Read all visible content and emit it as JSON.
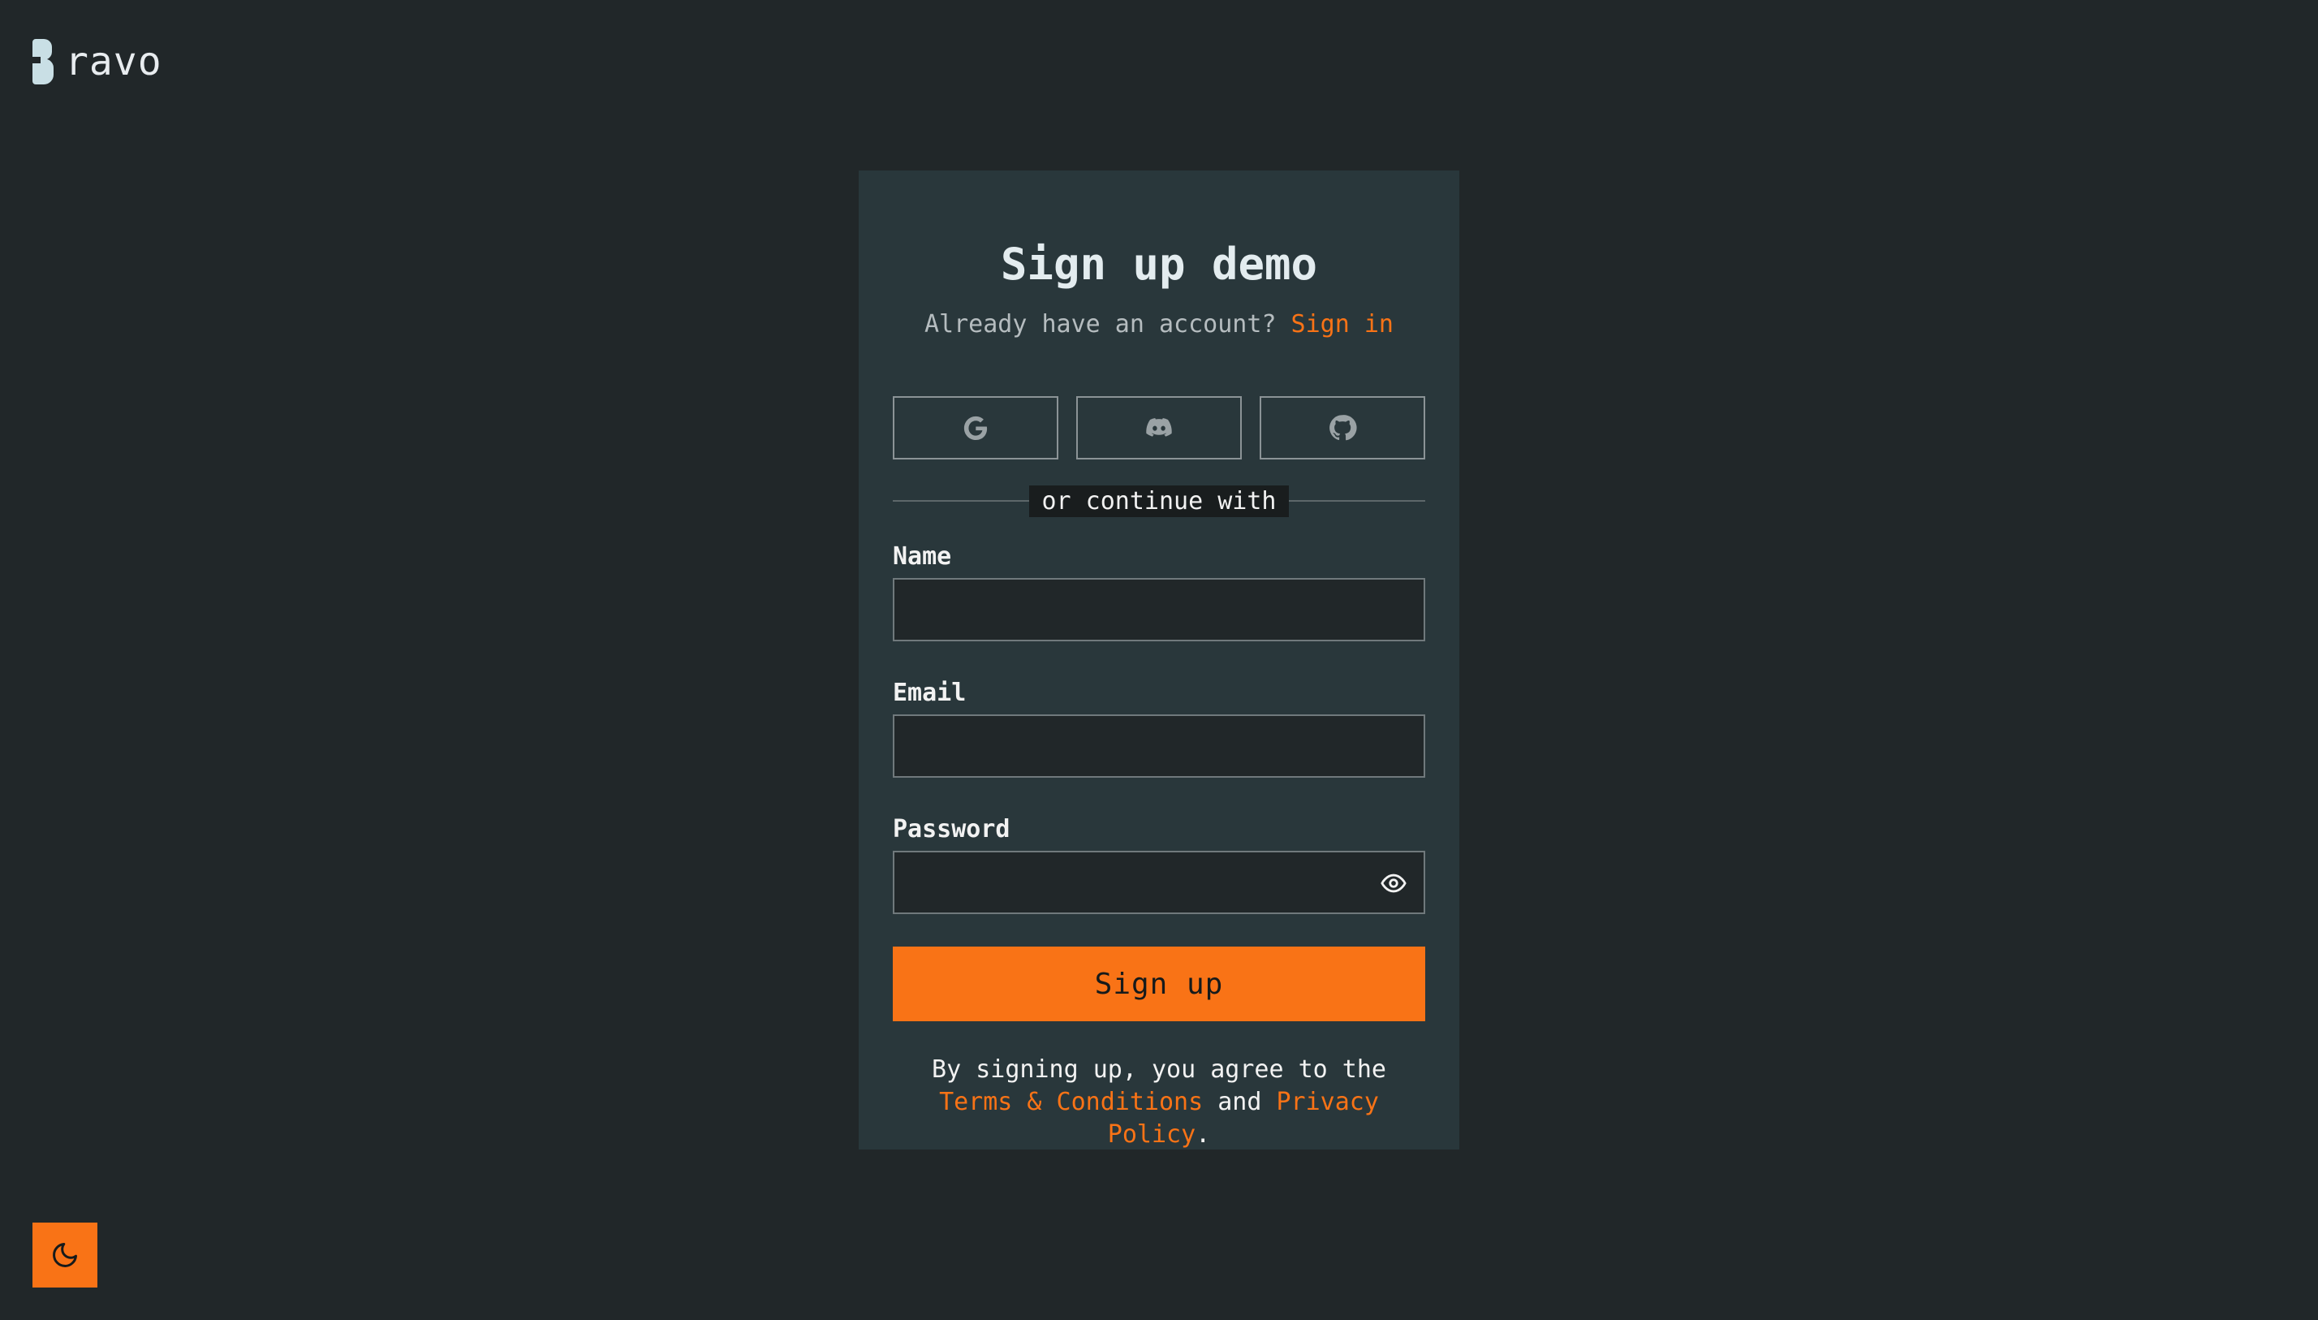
{
  "brand": {
    "logo_text": "ravo"
  },
  "form": {
    "title": "Sign up demo",
    "subtitle_text": "Already have an account?",
    "signin_link": "Sign in",
    "social": {
      "google_icon": "google-icon",
      "discord_icon": "discord-icon",
      "github_icon": "github-icon"
    },
    "divider_text": "or continue with",
    "fields": {
      "name_label": "Name",
      "name_value": "",
      "email_label": "Email",
      "email_value": "",
      "password_label": "Password",
      "password_value": ""
    },
    "submit_label": "Sign up",
    "terms": {
      "prefix": "By signing up, you agree to the",
      "terms_link": "Terms & Conditions",
      "middle": "and",
      "privacy_link": "Privacy Policy",
      "suffix": "."
    }
  },
  "theme_toggle_icon": "moon-icon",
  "colors": {
    "background": "#212729",
    "card": "#29373b",
    "accent": "#f97316"
  }
}
